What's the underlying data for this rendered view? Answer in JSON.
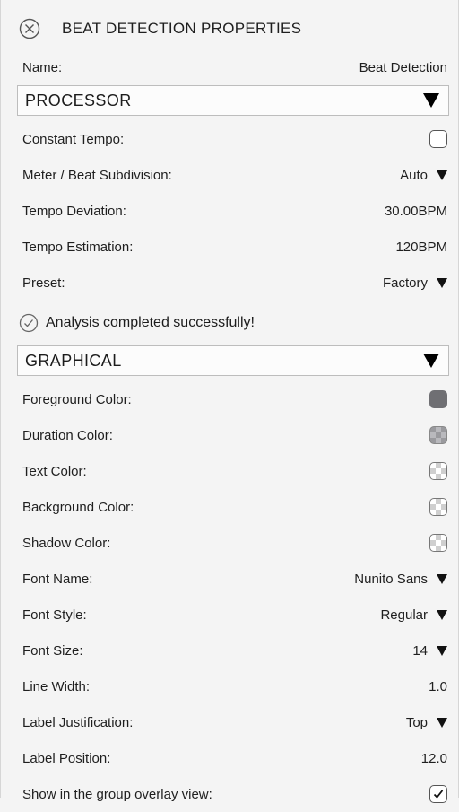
{
  "header": {
    "title": "BEAT DETECTION PROPERTIES",
    "close_icon": "close-circle-icon"
  },
  "name_row": {
    "label": "Name:",
    "value": "Beat Detection"
  },
  "processor": {
    "section_label": "PROCESSOR",
    "constant_tempo": {
      "label": "Constant Tempo:",
      "checked": false
    },
    "meter": {
      "label": "Meter / Beat Subdivision:",
      "value": "Auto"
    },
    "tempo_deviation": {
      "label": "Tempo Deviation:",
      "value": "30.00BPM"
    },
    "tempo_estimation": {
      "label": "Tempo Estimation:",
      "value": "120BPM"
    },
    "preset": {
      "label": "Preset:",
      "value": "Factory"
    }
  },
  "status": {
    "icon": "check-circle-icon",
    "text": "Analysis completed successfully!"
  },
  "graphical": {
    "section_label": "GRAPHICAL",
    "foreground_color": {
      "label": "Foreground Color:",
      "color": "#6f6f73"
    },
    "duration_color": {
      "label": "Duration Color:"
    },
    "text_color": {
      "label": "Text Color:"
    },
    "background_color": {
      "label": "Background Color:"
    },
    "shadow_color": {
      "label": "Shadow Color:"
    },
    "font_name": {
      "label": "Font Name:",
      "value": "Nunito Sans"
    },
    "font_style": {
      "label": "Font Style:",
      "value": "Regular"
    },
    "font_size": {
      "label": "Font Size:",
      "value": "14"
    },
    "line_width": {
      "label": "Line Width:",
      "value": "1.0"
    },
    "label_justification": {
      "label": "Label Justification:",
      "value": "Top"
    },
    "label_position": {
      "label": "Label Position:",
      "value": "12.0"
    },
    "show_in_overlay": {
      "label": "Show in the group overlay view:",
      "checked": true
    }
  }
}
